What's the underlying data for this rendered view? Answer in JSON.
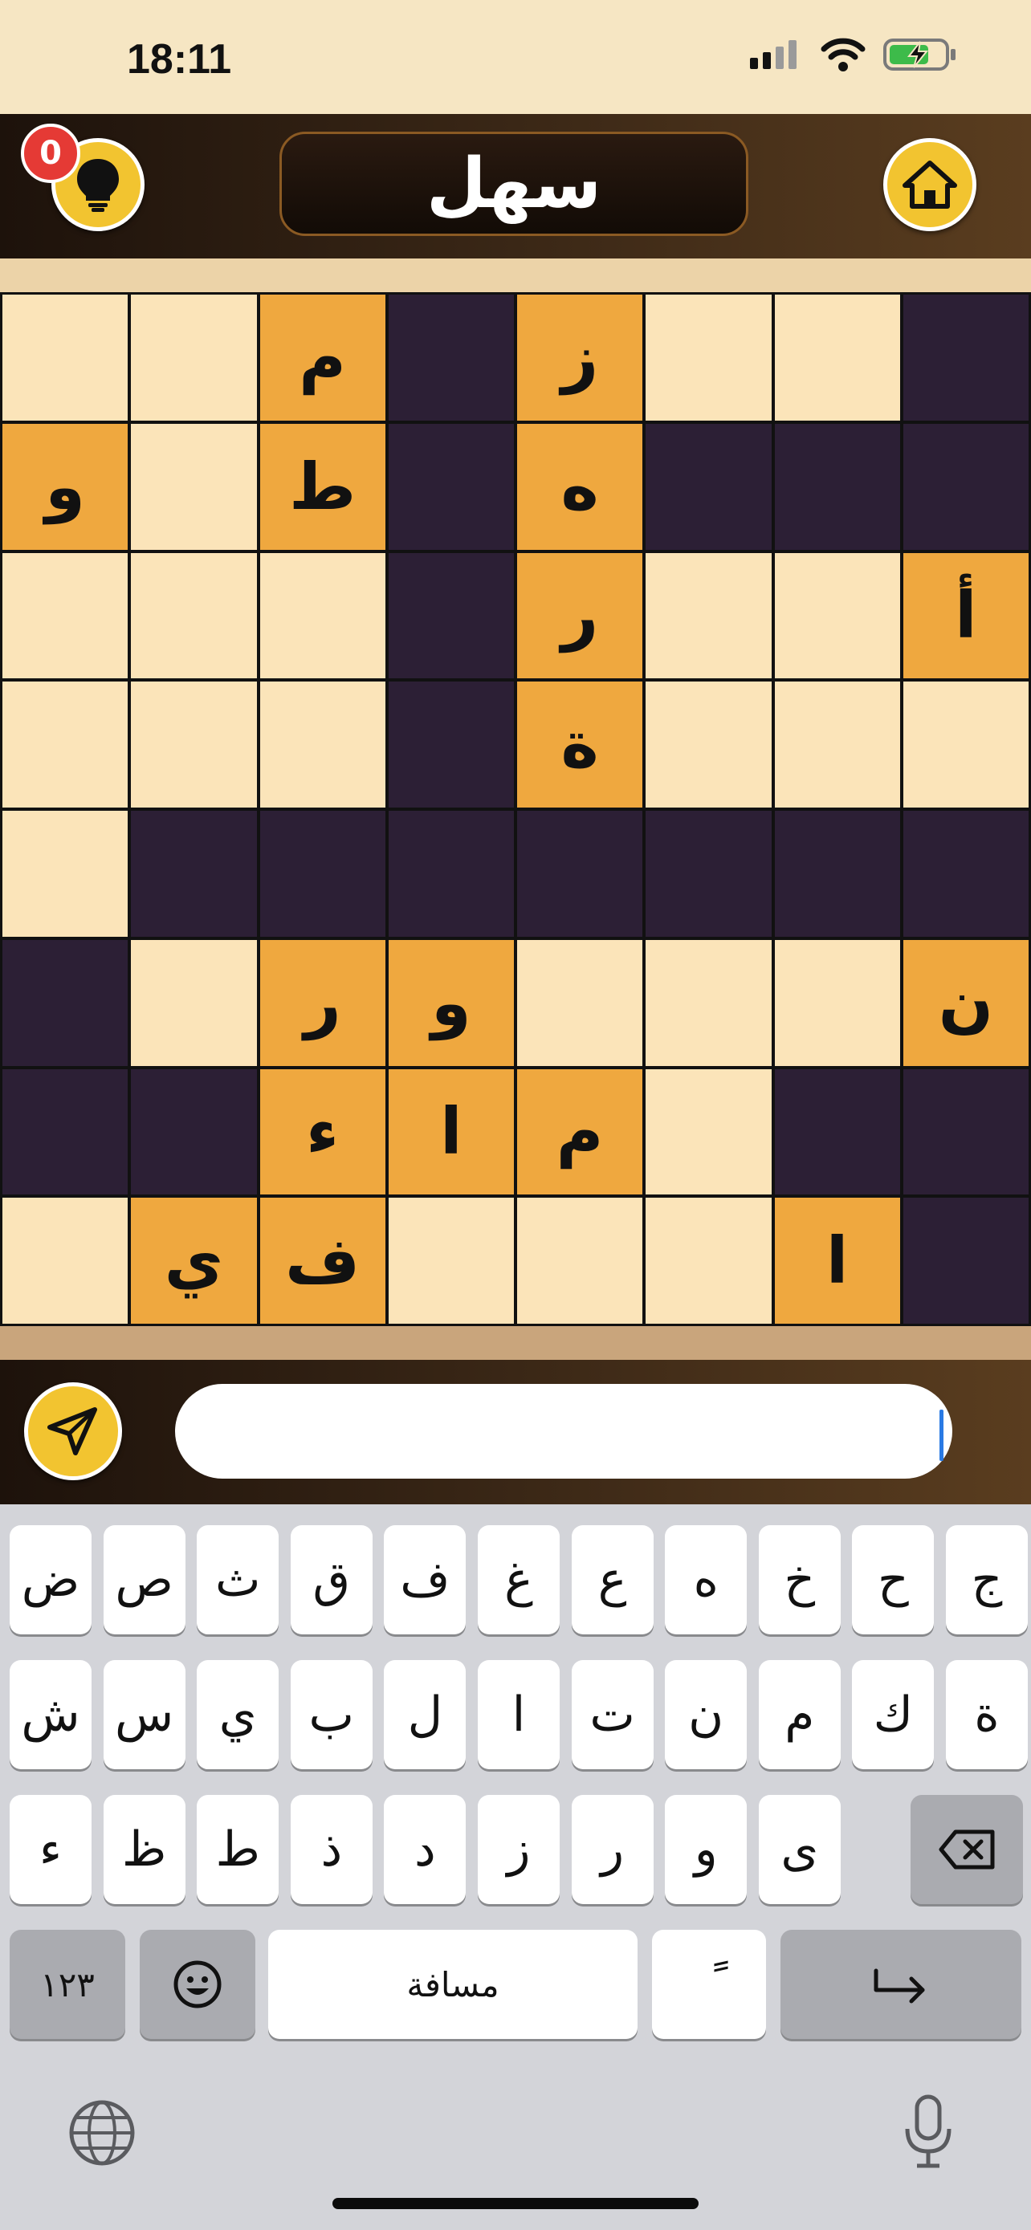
{
  "status_bar": {
    "time": "18:11"
  },
  "header": {
    "title": "سهل",
    "hint_count": "0"
  },
  "board": {
    "rows": [
      [
        "",
        "",
        "م",
        "#",
        "ز",
        "",
        "",
        "#"
      ],
      [
        "و",
        "",
        "ط",
        "#",
        "ه",
        "#",
        "#",
        "#"
      ],
      [
        "",
        "",
        "",
        "#",
        "ر",
        "",
        "",
        "أ"
      ],
      [
        "",
        "",
        "",
        "#",
        "ة",
        "",
        "",
        ""
      ],
      [
        "",
        "#",
        "#",
        "#",
        "#",
        "#",
        "#",
        "#"
      ],
      [
        "#",
        "",
        "ر",
        "و",
        "",
        "",
        "",
        "ن"
      ],
      [
        "#",
        "#",
        "ء",
        "ا",
        "م",
        "",
        "#",
        "#"
      ],
      [
        "",
        "ي",
        "ف",
        "",
        "",
        "",
        "ا",
        "#"
      ]
    ]
  },
  "input": {
    "value": "",
    "placeholder": ""
  },
  "keyboard": {
    "row1": [
      "ض",
      "ص",
      "ث",
      "ق",
      "ف",
      "غ",
      "ع",
      "ه",
      "خ",
      "ح",
      "ج"
    ],
    "row2": [
      "ش",
      "س",
      "ي",
      "ب",
      "ل",
      "ا",
      "ت",
      "ن",
      "م",
      "ك",
      "ة"
    ],
    "row3": [
      "ء",
      "ظ",
      "ط",
      "ذ",
      "د",
      "ز",
      "ر",
      "و",
      "ى"
    ],
    "numbers_label": "١٢٣",
    "space_label": "مسافة",
    "diacritic_label": "ً"
  },
  "colors": {
    "empty_cell": "#fbe4b9",
    "block_cell": "#2c1f35",
    "filled_cell": "#efa83f",
    "button_yellow": "#f2c430",
    "badge_red": "#e53a35"
  },
  "icons": [
    "signal-icon",
    "wifi-icon",
    "battery-icon",
    "lightbulb-icon",
    "home-icon",
    "send-icon",
    "backspace-icon",
    "emoji-icon",
    "return-icon",
    "globe-icon",
    "microphone-icon"
  ]
}
